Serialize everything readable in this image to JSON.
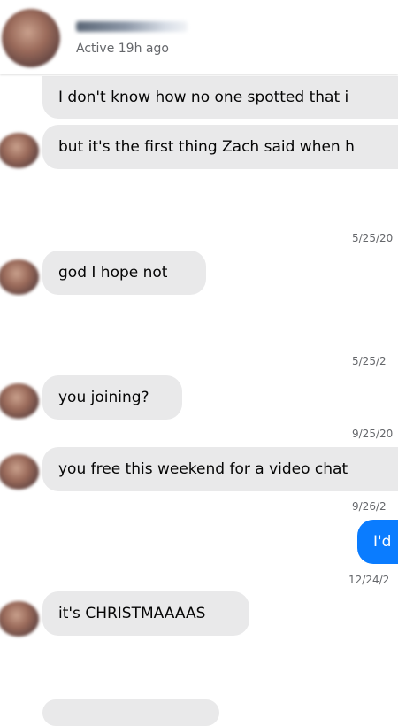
{
  "header": {
    "status": "Active 19h ago"
  },
  "messages": [
    {
      "text": "I don't know how no one spotted that i"
    },
    {
      "text": "but it's the first thing Zach said when h"
    },
    {
      "text": "god I hope not"
    },
    {
      "text": "you joining?"
    },
    {
      "text": "you free this weekend for a video chat"
    },
    {
      "text": "I'd"
    },
    {
      "text": "it's CHRISTMAAAAS"
    },
    {
      "text": ""
    }
  ],
  "timestamps": [
    "5/25/20",
    "5/25/2",
    "9/25/20",
    "9/26/2",
    "12/24/2"
  ],
  "colors": {
    "incoming_bubble": "#e9e9ea",
    "outgoing_bubble": "#0a7cff",
    "timestamp_text": "#65676b"
  }
}
